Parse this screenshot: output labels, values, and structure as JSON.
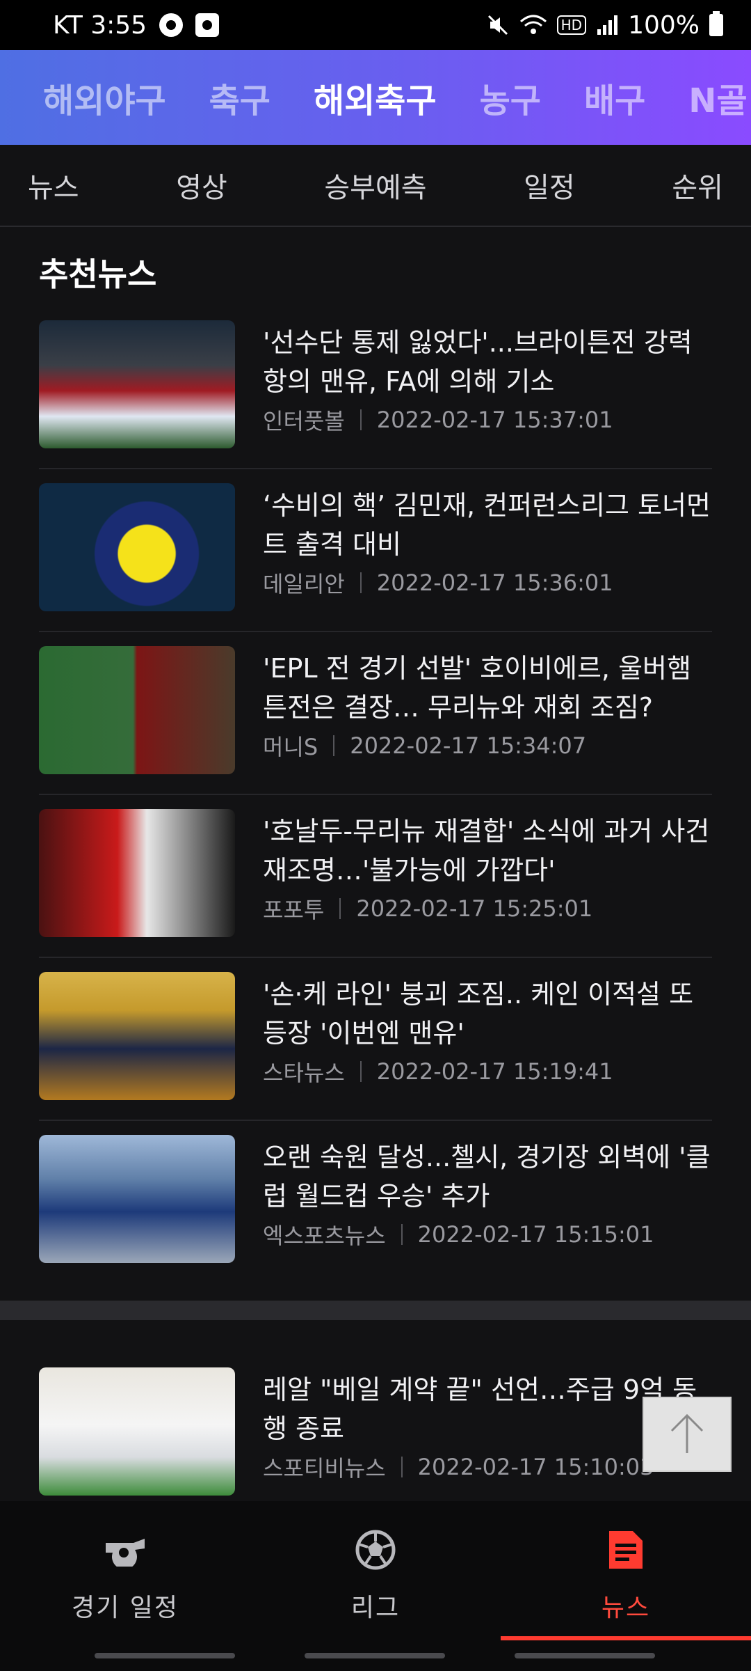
{
  "status_bar": {
    "carrier_time": "KT 3:55",
    "battery": "100%",
    "hd_label": "HD"
  },
  "sport_tabs": [
    {
      "label": "해외야구",
      "active": false
    },
    {
      "label": "축구",
      "active": false
    },
    {
      "label": "해외축구",
      "active": true
    },
    {
      "label": "농구",
      "active": false
    },
    {
      "label": "배구",
      "active": false
    },
    {
      "label": "N골",
      "active": false
    }
  ],
  "sub_tabs": [
    "뉴스",
    "영상",
    "승부예측",
    "일정",
    "순위"
  ],
  "section_title": "추천뉴스",
  "news": [
    {
      "headline": "'선수단 통제 잃었다'...브라이튼전 강력 항의 맨유, FA에 의해 기소",
      "source": "인터풋볼",
      "time": "2022-02-17 15:37:01"
    },
    {
      "headline": "‘수비의 핵’ 김민재, 컨퍼런스리그 토너먼트 출격 대비",
      "source": "데일리안",
      "time": "2022-02-17 15:36:01"
    },
    {
      "headline": "'EPL 전 경기 선발' 호이비에르, 울버햄튼전은 결장… 무리뉴와 재회 조짐?",
      "source": "머니S",
      "time": "2022-02-17 15:34:07"
    },
    {
      "headline": "'호날두-무리뉴 재결합' 소식에 과거 사건 재조명…'불가능에 가깝다'",
      "source": "포포투",
      "time": "2022-02-17 15:25:01"
    },
    {
      "headline": "'손·케 라인' 붕괴 조짐.. 케인 이적설 또 등장 '이번엔 맨유'",
      "source": "스타뉴스",
      "time": "2022-02-17 15:19:41"
    },
    {
      "headline": "오랜 숙원 달성...첼시, 경기장 외벽에 '클럽 월드컵 우승' 추가",
      "source": "엑스포츠뉴스",
      "time": "2022-02-17 15:15:01"
    }
  ],
  "news2": [
    {
      "headline": "레알 \"베일 계약 끝\" 선언…주급 9억 동행 종료",
      "source": "스포티비뉴스",
      "time": "2022-02-17 15:10:03"
    }
  ],
  "bottom_nav": [
    {
      "label": "경기 일정",
      "icon": "whistle-icon",
      "active": false
    },
    {
      "label": "리그",
      "icon": "soccer-ball-icon",
      "active": false
    },
    {
      "label": "뉴스",
      "icon": "news-document-icon",
      "active": true
    }
  ],
  "colors": {
    "accent": "#ff3b30",
    "tab_gradient_start": "#4f6fe3",
    "tab_gradient_end": "#8a4bff",
    "background": "#121214"
  }
}
